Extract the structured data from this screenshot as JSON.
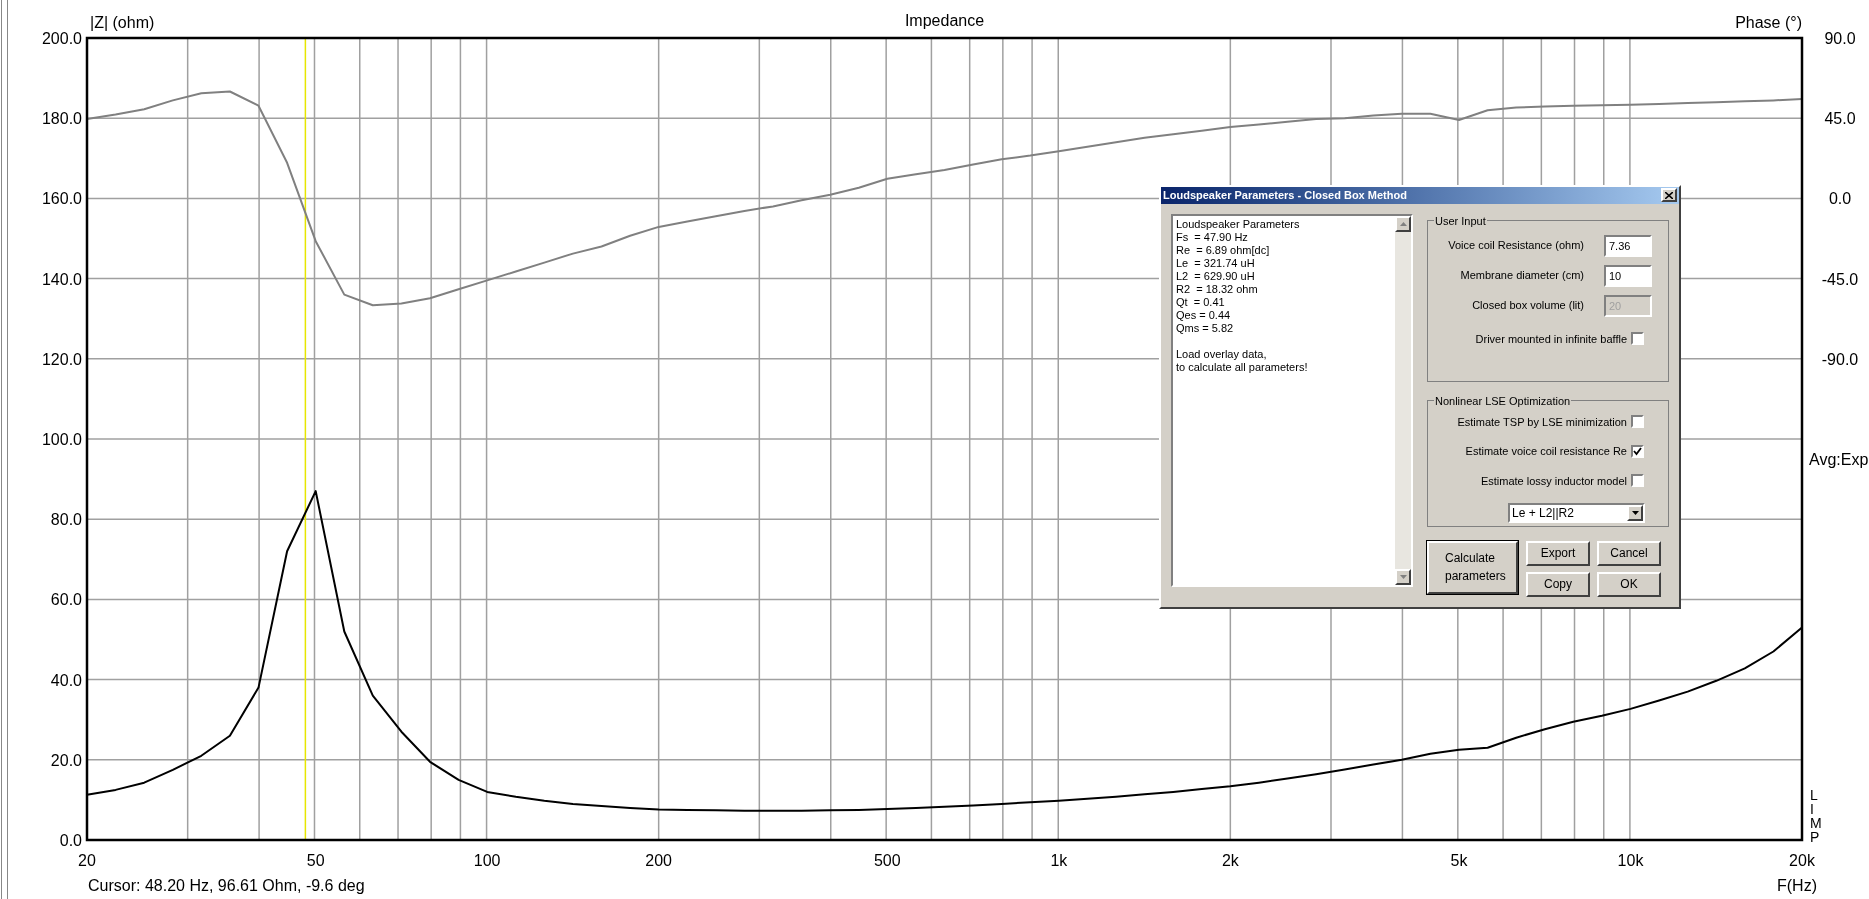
{
  "chart_data": {
    "type": "line",
    "title": "Impedance",
    "xlabel": "F(Hz)",
    "ylabel": "|Z| (ohm)",
    "y2label": "Phase (°)",
    "ylim": [
      0,
      200
    ],
    "y2lim": [
      -360,
      90
    ],
    "categories": [
      "20",
      null,
      null,
      null,
      null,
      null,
      null,
      null,
      "50",
      null,
      null,
      null,
      null,
      null,
      "100",
      null,
      null,
      null,
      null,
      null,
      "200",
      null,
      null,
      null,
      null,
      null,
      null,
      null,
      "500",
      null,
      null,
      null,
      null,
      null,
      "1k",
      null,
      null,
      null,
      null,
      null,
      "2k",
      null,
      null,
      null,
      null,
      null,
      null,
      null,
      "5k",
      null,
      null,
      null,
      null,
      null,
      "10k",
      null,
      null,
      null,
      null,
      null,
      "20k"
    ],
    "series": [
      {
        "color": "#000000",
        "values": [
          11.3,
          12.5,
          14.3,
          17.5,
          21,
          26,
          38,
          72,
          87,
          52,
          36,
          27,
          19.5,
          15,
          12,
          10.8,
          9.8,
          9,
          8.5,
          8,
          7.6,
          7.5,
          7.4,
          7.3,
          7.3,
          7.3,
          7.4,
          7.5,
          7.7,
          8,
          8.3,
          8.6,
          9,
          9.4,
          9.8,
          10.3,
          10.8,
          11.4,
          12,
          12.7,
          13.4,
          14.3,
          15.3,
          16.4,
          17.6,
          18.8,
          20,
          21.5,
          22.5,
          23,
          25.5,
          27.6,
          29.5,
          31,
          32.7,
          34.8,
          37,
          39.7,
          42.8,
          47,
          53
        ]
      },
      {
        "color": "#808080",
        "axis": "y2",
        "values": [
          44.5,
          47,
          50,
          55,
          59,
          60,
          52,
          20,
          -24,
          -54,
          -60,
          -59,
          -56,
          -51,
          -46,
          -41,
          -36,
          -31,
          -27,
          -21,
          -16,
          -13,
          -10,
          -7,
          -4.5,
          -1,
          2,
          6,
          11,
          13.5,
          16,
          19,
          22,
          24,
          26.5,
          29,
          31.5,
          34,
          36,
          38,
          40,
          41.5,
          43,
          44.5,
          45,
          46.5,
          47.5,
          47.5,
          44,
          49.5,
          51,
          51.5,
          52,
          52.3,
          52.6,
          53,
          53.5,
          54,
          54.5,
          55,
          55.8
        ]
      }
    ],
    "yticks": [
      {
        "value": 0,
        "label": "0.0"
      },
      {
        "value": 20,
        "label": "20.0"
      },
      {
        "value": 40,
        "label": "40.0"
      },
      {
        "value": 60,
        "label": "60.0"
      },
      {
        "value": 80,
        "label": "80.0"
      },
      {
        "value": 100,
        "label": "100.0"
      },
      {
        "value": 120,
        "label": "120.0"
      },
      {
        "value": 140,
        "label": "140.0"
      },
      {
        "value": 160,
        "label": "160.0"
      },
      {
        "value": 180,
        "label": "180.0"
      },
      {
        "value": 200,
        "label": "200.0"
      }
    ],
    "y2ticks": [
      {
        "value": 90,
        "label": "90.0"
      },
      {
        "value": 45,
        "label": "45.0"
      },
      {
        "value": 0,
        "label": "0.0"
      },
      {
        "value": -45,
        "label": "-45.0"
      },
      {
        "value": -90,
        "label": "-90.0"
      }
    ],
    "grid": true
  },
  "averaging_label": "Avg:Exp",
  "channel_letters": [
    "L",
    "I",
    "M",
    "P"
  ],
  "status": "Cursor: 48.20 Hz, 96.61 Ohm, -9.6 deg",
  "dialog": {
    "title": "Loudspeaker Parameters - Closed Box Method",
    "results": [
      "Loudspeaker Parameters",
      "Fs  = 47.90 Hz",
      "Re  = 6.89 ohm[dc]",
      "Le  = 321.74 uH",
      "L2  = 629.90 uH",
      "R2  = 18.32 ohm",
      "Qt  = 0.41",
      "Qes = 0.44",
      "Qms = 5.82"
    ],
    "note": "Load overlay data,\nto calculate all parameters!",
    "user_input": {
      "title": "User Input",
      "fields": [
        {
          "label": "Voice coil Resistance (ohm)",
          "value": "7.36",
          "disabled": false
        },
        {
          "label": "Membrane diameter (cm)",
          "value": "10",
          "disabled": false
        },
        {
          "label": "Closed box volume (lit)",
          "value": "20",
          "disabled": true
        }
      ],
      "checkboxes": [
        {
          "label": "Driver mounted in infinite baffle",
          "checked": false
        }
      ]
    },
    "optimization": {
      "title": "Nonlinear LSE Optimization",
      "checkboxes": [
        {
          "label": "Estimate TSP by LSE minimization",
          "checked": false
        },
        {
          "label": "Estimate voice coil resistance Re",
          "checked": true
        },
        {
          "label": "Estimate lossy inductor model",
          "checked": false
        }
      ],
      "model": "Le + L2||R2"
    },
    "buttons": [
      {
        "label": "Calculate parameters",
        "default": true
      },
      {
        "label": "Export",
        "default": false
      },
      {
        "label": "Cancel",
        "default": false
      },
      {
        "label": "Copy",
        "default": false
      },
      {
        "label": "OK",
        "default": false
      }
    ]
  }
}
